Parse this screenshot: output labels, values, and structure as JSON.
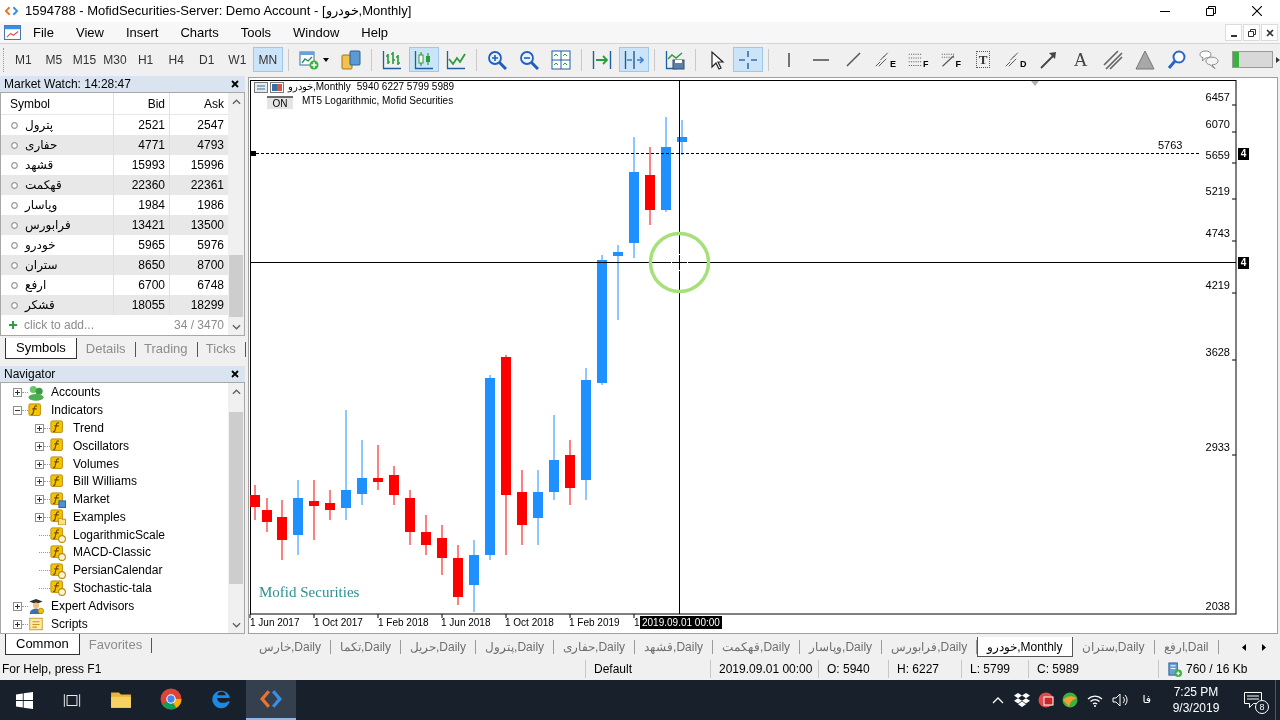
{
  "window": {
    "title": "1594788 - MofidSecurities-Server: Demo Account - [خودرو,Monthly]"
  },
  "menu": [
    "File",
    "View",
    "Insert",
    "Charts",
    "Tools",
    "Window",
    "Help"
  ],
  "toolbar": {
    "timeframes": [
      {
        "label": "M1",
        "selected": false
      },
      {
        "label": "M5",
        "selected": false
      },
      {
        "label": "M15",
        "selected": false
      },
      {
        "label": "M30",
        "selected": false
      },
      {
        "label": "H1",
        "selected": false
      },
      {
        "label": "H4",
        "selected": false
      },
      {
        "label": "D1",
        "selected": false
      },
      {
        "label": "W1",
        "selected": false
      },
      {
        "label": "MN",
        "selected": true
      }
    ],
    "tool_groups": [
      [
        {
          "kind": "new-chart",
          "selected": false
        },
        {
          "kind": "profiles",
          "selected": false
        }
      ],
      [
        {
          "kind": "bar-chart",
          "selected": false
        },
        {
          "kind": "candlesticks",
          "selected": true
        },
        {
          "kind": "line-chart",
          "selected": false
        }
      ],
      [
        {
          "kind": "zoom-in",
          "selected": false
        },
        {
          "kind": "zoom-out",
          "selected": false
        },
        {
          "kind": "tile",
          "selected": false
        }
      ],
      [
        {
          "kind": "autoscroll",
          "selected": false
        },
        {
          "kind": "chart-shift",
          "selected": true
        }
      ],
      [
        {
          "kind": "templates",
          "selected": false
        }
      ],
      [
        {
          "kind": "cursor",
          "selected": false
        },
        {
          "kind": "crosshair",
          "selected": true
        }
      ],
      [
        {
          "kind": "vertical-line",
          "selected": false
        },
        {
          "kind": "horizontal-line",
          "selected": false
        },
        {
          "kind": "trendline",
          "selected": false
        },
        {
          "kind": "channel",
          "selected": false,
          "glyph": "E"
        },
        {
          "kind": "fibo",
          "selected": false,
          "glyph": "F"
        },
        {
          "kind": "fibo-fan",
          "selected": false,
          "glyph": "F"
        },
        {
          "kind": "text-label",
          "selected": false,
          "glyph": "T"
        },
        {
          "kind": "elliott",
          "selected": false,
          "glyph": "D"
        },
        {
          "kind": "arrow",
          "selected": false
        },
        {
          "kind": "text",
          "selected": false,
          "glyph": "A"
        },
        {
          "kind": "parallel",
          "selected": false
        },
        {
          "kind": "triangle",
          "selected": false
        },
        {
          "kind": "search",
          "selected": false
        },
        {
          "kind": "chat",
          "selected": false
        }
      ]
    ],
    "progress": {
      "level": 0.15
    }
  },
  "market_watch": {
    "title": "Market Watch: 14:28:47",
    "columns": [
      "Symbol",
      "Bid",
      "Ask"
    ],
    "rows": [
      {
        "symbol": "پترول",
        "bid": "2521",
        "ask": "2547"
      },
      {
        "symbol": "حفاری",
        "bid": "4771",
        "ask": "4793"
      },
      {
        "symbol": "قشهد",
        "bid": "15993",
        "ask": "15996"
      },
      {
        "symbol": "قهکمت",
        "bid": "22360",
        "ask": "22361"
      },
      {
        "symbol": "وپاسار",
        "bid": "1984",
        "ask": "1986"
      },
      {
        "symbol": "فرابورس",
        "bid": "13421",
        "ask": "13500"
      },
      {
        "symbol": "خودرو",
        "bid": "5965",
        "ask": "5976"
      },
      {
        "symbol": "ستران",
        "bid": "8650",
        "ask": "8700"
      },
      {
        "symbol": "ارفع",
        "bid": "6700",
        "ask": "6748"
      },
      {
        "symbol": "قشکر",
        "bid": "18055",
        "ask": "18299"
      }
    ],
    "add_row": {
      "label": "click to add...",
      "count": "34 / 3470"
    },
    "tabs": [
      {
        "label": "Symbols",
        "selected": true
      },
      {
        "label": "Details",
        "selected": false
      },
      {
        "label": "Trading",
        "selected": false
      },
      {
        "label": "Ticks",
        "selected": false
      }
    ]
  },
  "navigator": {
    "title": "Navigator",
    "items": [
      {
        "label": "Accounts",
        "kind": "accounts",
        "expanded": false
      },
      {
        "label": "Indicators",
        "kind": "function",
        "expanded": true,
        "children": [
          {
            "label": "Trend",
            "kind": "function",
            "expanded": false
          },
          {
            "label": "Oscillators",
            "kind": "function",
            "expanded": false
          },
          {
            "label": "Volumes",
            "kind": "function",
            "expanded": false
          },
          {
            "label": "Bill Williams",
            "kind": "function",
            "expanded": false
          },
          {
            "label": "Market",
            "kind": "function-market",
            "expanded": false
          },
          {
            "label": "Examples",
            "kind": "function-folder",
            "expanded": false
          },
          {
            "label": "LogarithmicScale",
            "kind": "function-custom"
          },
          {
            "label": "MACD-Classic",
            "kind": "function-custom"
          },
          {
            "label": "PersianCalendar",
            "kind": "function-custom"
          },
          {
            "label": "Stochastic-tala",
            "kind": "function-custom"
          }
        ]
      },
      {
        "label": "Expert Advisors",
        "kind": "experts",
        "expanded": false
      },
      {
        "label": "Scripts",
        "kind": "scripts",
        "expanded": false
      }
    ],
    "tabs": [
      {
        "label": "Common",
        "selected": true
      },
      {
        "label": "Favorites",
        "selected": false
      }
    ]
  },
  "chart": {
    "symbol": "خودرو,Monthly",
    "ohlc": "5940 6227 5799 5989",
    "on_button": "ON",
    "indicator": "MT5 Logarithmic, Mofid Securities",
    "text_object": "Mofid Securities",
    "line_label": "5763",
    "price_labels": [
      "6457",
      "6070",
      "5659",
      "5219",
      "4743",
      "4219",
      "3628",
      "2933",
      "2038"
    ],
    "price_markers": [
      "4",
      "4"
    ],
    "time_labels": [
      "1 Jun 2017",
      "1 Oct 2017",
      "1 Feb 2018",
      "1 Jun 2018",
      "1 Oct 2018",
      "1 Feb 2019",
      "1"
    ],
    "crosshair_time": "2019.09.01 00:00"
  },
  "chart_tabs": [
    {
      "label": "خارس,Daily",
      "selected": false
    },
    {
      "label": "تکما,Daily",
      "selected": false
    },
    {
      "label": "حریل,Daily",
      "selected": false
    },
    {
      "label": "پترول,Daily",
      "selected": false
    },
    {
      "label": "حفاری,Daily",
      "selected": false
    },
    {
      "label": "قشهد,Daily",
      "selected": false
    },
    {
      "label": "قهکمت,Daily",
      "selected": false
    },
    {
      "label": "وپاسار,Daily",
      "selected": false
    },
    {
      "label": "فرابورس,Daily",
      "selected": false
    },
    {
      "label": "خودرو,Monthly",
      "selected": true
    },
    {
      "label": "ستران,Daily",
      "selected": false
    },
    {
      "label": "ارفع,Dail",
      "selected": false
    }
  ],
  "status_bar": {
    "help": "For Help, press F1",
    "profile": "Default",
    "time": "2019.09.01 00:00",
    "open": "O: 5940",
    "high": "H: 6227",
    "low": "L: 5799",
    "close": "C: 5989",
    "traffic": "760 / 16 Kb"
  },
  "taskbar": {
    "apps": [
      {
        "kind": "folder",
        "selected": false
      },
      {
        "kind": "browser-circle",
        "selected": false
      },
      {
        "kind": "browser-e",
        "selected": false
      },
      {
        "kind": "terminal",
        "selected": true
      }
    ],
    "language": "فا",
    "time": "7:25 PM",
    "date": "9/3/2019",
    "notifications": "8"
  }
}
